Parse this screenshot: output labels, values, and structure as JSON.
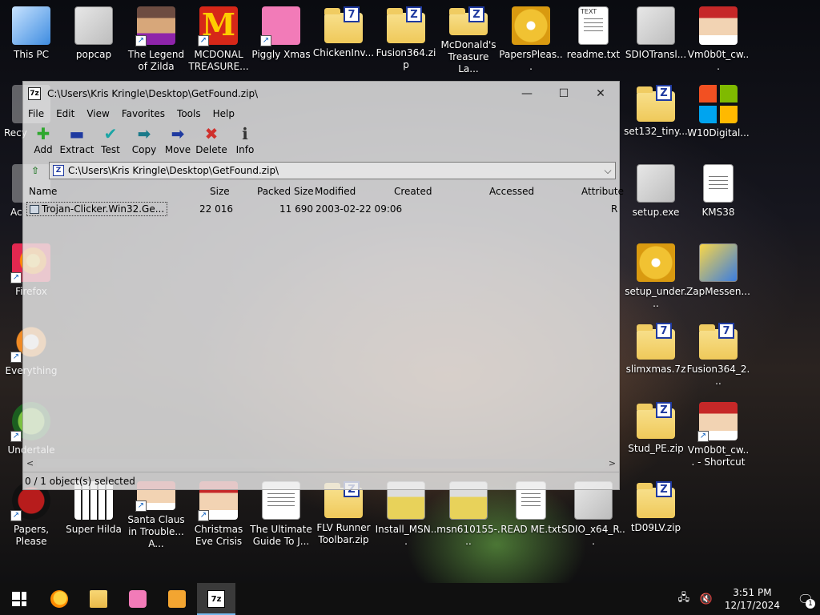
{
  "desktop": {
    "icons": [
      {
        "label": "This PC"
      },
      {
        "label": "popcap"
      },
      {
        "label": "The Legend of Zilda"
      },
      {
        "label": "MCDONAL TREASURE..."
      },
      {
        "label": "Piggly Xmas"
      },
      {
        "label": "ChickenInv..."
      },
      {
        "label": "Fusion364.zip"
      },
      {
        "label": "McDonald's Treasure La..."
      },
      {
        "label": "PapersPleas..."
      },
      {
        "label": "readme.txt"
      },
      {
        "label": "SDIOTransl..."
      },
      {
        "label": "Vm0b0t_cw..."
      },
      {
        "label": "set132_tiny..."
      },
      {
        "label": "W10Digital..."
      },
      {
        "label": "setup.exe"
      },
      {
        "label": "KMS38"
      },
      {
        "label": "setup_under..."
      },
      {
        "label": "ZapMessen..."
      },
      {
        "label": "slimxmas.7z"
      },
      {
        "label": "Fusion364_2..."
      },
      {
        "label": "Stud_PE.zip"
      },
      {
        "label": "Vm0b0t_cw... - Shortcut"
      },
      {
        "label": "tD09LV.zip"
      },
      {
        "label": "Papers, Please"
      },
      {
        "label": "Super Hilda"
      },
      {
        "label": "Santa Claus in Trouble... A..."
      },
      {
        "label": "Christmas Eve Crisis"
      },
      {
        "label": "The Ultimate Guide To J..."
      },
      {
        "label": "FLV Runner Toolbar.zip"
      },
      {
        "label": "Install_MSN..."
      },
      {
        "label": "msn610155-..."
      },
      {
        "label": "READ ME.txt"
      },
      {
        "label": "SDIO_x64_R..."
      },
      {
        "label": "Recy"
      },
      {
        "label": "Ac"
      },
      {
        "label": "Firefox"
      },
      {
        "label": "Everything"
      },
      {
        "label": "Undertale"
      }
    ],
    "badge_letters": {
      "zip": "Z",
      "sevenzip": "7",
      "text_icon": "TEXT"
    }
  },
  "window": {
    "app_icon_text": "7z",
    "title": "C:\\Users\\Kris Kringle\\Desktop\\GetFound.zip\\",
    "minimize_glyph": "—",
    "maximize_glyph": "☐",
    "close_glyph": "✕",
    "menu": [
      "File",
      "Edit",
      "View",
      "Favorites",
      "Tools",
      "Help"
    ],
    "toolbar": [
      {
        "label": "Add",
        "icon": "add-icon",
        "color": "#2fa82f",
        "glyph": "✚"
      },
      {
        "label": "Extract",
        "icon": "extract-icon",
        "color": "#1f3aa0",
        "glyph": "▬"
      },
      {
        "label": "Test",
        "icon": "test-icon",
        "color": "#1aa5a5",
        "glyph": "✔"
      },
      {
        "label": "Copy",
        "icon": "copy-icon",
        "color": "#1a7a8a",
        "glyph": "➡"
      },
      {
        "label": "Move",
        "icon": "move-icon",
        "color": "#1f3aa0",
        "glyph": "➡"
      },
      {
        "label": "Delete",
        "icon": "delete-icon",
        "color": "#d0312d",
        "glyph": "✖"
      },
      {
        "label": "Info",
        "icon": "info-icon",
        "color": "#333333",
        "glyph": "ℹ"
      }
    ],
    "address": {
      "path": "C:\\Users\\Kris Kringle\\Desktop\\GetFound.zip\\",
      "up_glyph": "⇧",
      "zip_glyph": "Z",
      "dropdown_glyph": "⌵"
    },
    "columns": [
      "Name",
      "Size",
      "Packed Size",
      "Modified",
      "Created",
      "Accessed",
      "Attribute"
    ],
    "rows": [
      {
        "name": "Trojan-Clicker.Win32.Ge...",
        "size": "22 016",
        "packed": "11 690",
        "modified": "2003-02-22 09:06",
        "created": "",
        "accessed": "",
        "attribute": "R"
      }
    ],
    "scroll": {
      "left_glyph": "<",
      "right_glyph": ">"
    },
    "status": "0 / 1 object(s) selected"
  },
  "taskbar": {
    "tray": {
      "network_glyph": "🖧",
      "volume_glyph": "🔇",
      "time": "3:51 PM",
      "date": "12/17/2024",
      "notif_glyph": "🗨",
      "notif_count": "1"
    },
    "app_icon_7z": "7z"
  }
}
